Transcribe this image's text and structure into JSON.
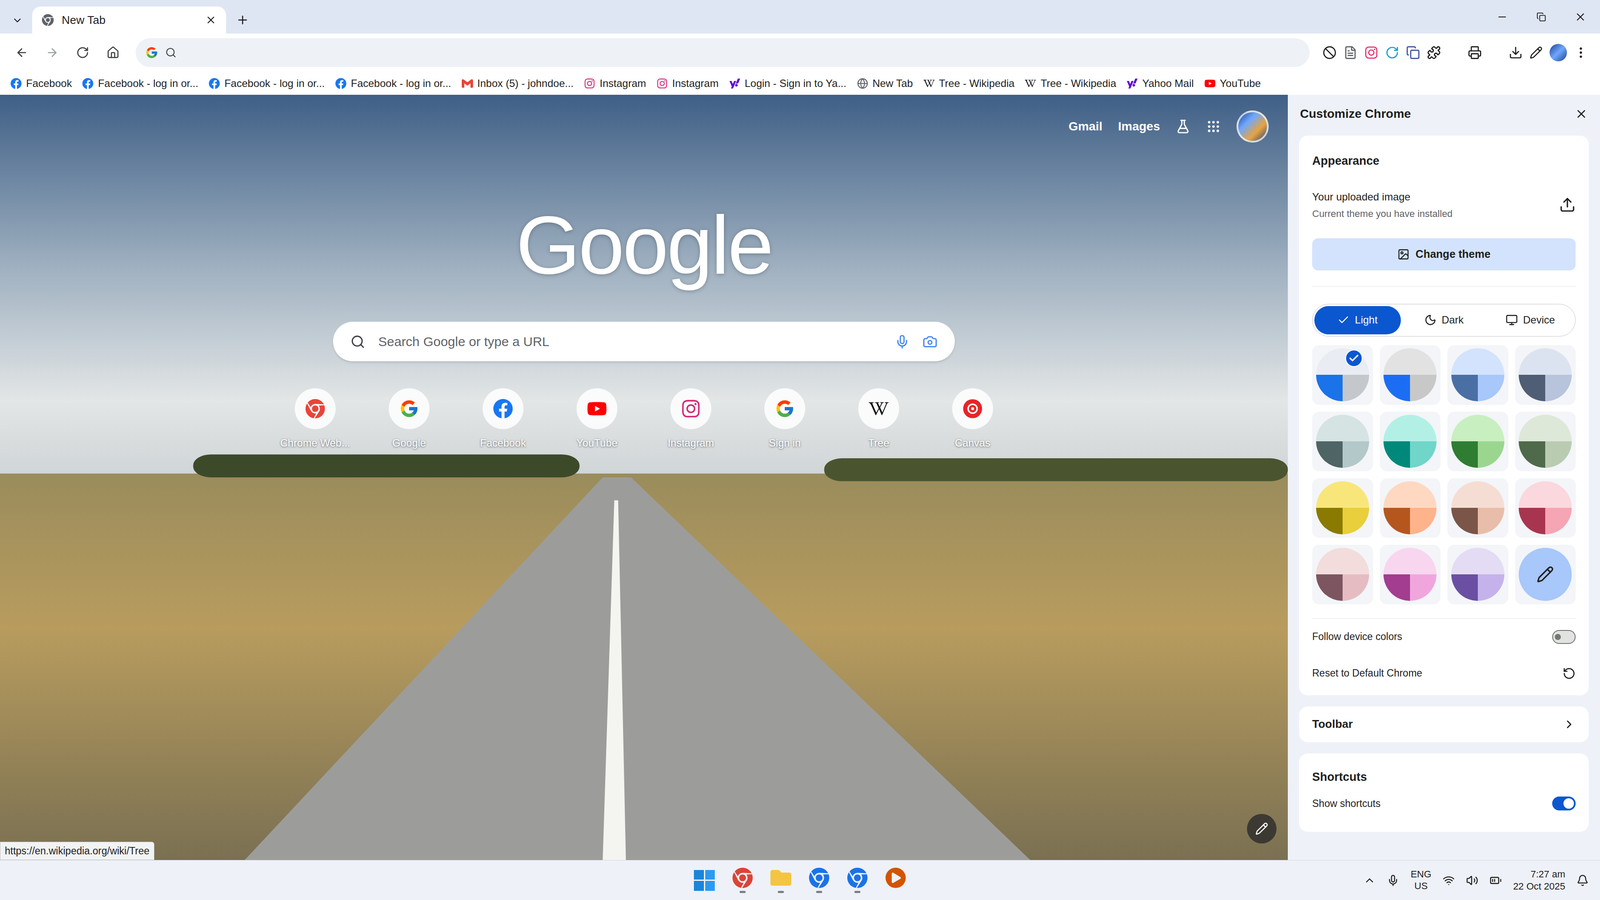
{
  "tabs": [
    {
      "label": "New Tab",
      "selected": true
    }
  ],
  "bookmarks": [
    {
      "label": "Facebook",
      "kind": "facebook"
    },
    {
      "label": "Facebook - log in or...",
      "kind": "facebook"
    },
    {
      "label": "Facebook - log in or...",
      "kind": "facebook"
    },
    {
      "label": "Facebook - log in or...",
      "kind": "facebook"
    },
    {
      "label": "Inbox (5) - johndoe...",
      "kind": "gmail"
    },
    {
      "label": "Instagram",
      "kind": "instagram"
    },
    {
      "label": "Instagram",
      "kind": "instagram"
    },
    {
      "label": "Login - Sign in to Ya...",
      "kind": "yahoo"
    },
    {
      "label": "New Tab",
      "kind": "globe"
    },
    {
      "label": "Tree - Wikipedia",
      "kind": "wikipedia"
    },
    {
      "label": "Tree - Wikipedia",
      "kind": "wikipedia"
    },
    {
      "label": "Yahoo Mail",
      "kind": "yahoo"
    },
    {
      "label": "YouTube",
      "kind": "youtube"
    }
  ],
  "ntp": {
    "links": [
      "Gmail",
      "Images"
    ],
    "logo": "Google",
    "search_placeholder": "Search Google or type a URL",
    "shortcuts": [
      {
        "label": "Chrome Web...",
        "kind": "webstore"
      },
      {
        "label": "Google",
        "kind": "google"
      },
      {
        "label": "Facebook",
        "kind": "facebook"
      },
      {
        "label": "YouTube",
        "kind": "youtube"
      },
      {
        "label": "Instagram",
        "kind": "instagram"
      },
      {
        "label": "Sign in",
        "kind": "google"
      },
      {
        "label": "Tree",
        "kind": "wikipedia"
      },
      {
        "label": "Canvas",
        "kind": "canvas"
      }
    ]
  },
  "status_url": "https://en.wikipedia.org/wiki/Tree",
  "panel": {
    "title": "Customize Chrome",
    "appearance": {
      "heading": "Appearance",
      "theme_title": "Your uploaded image",
      "theme_subtitle": "Current theme you have installed",
      "change_theme": "Change theme",
      "modes": [
        {
          "label": "Light",
          "kind": "light",
          "selected": true
        },
        {
          "label": "Dark",
          "kind": "dark",
          "selected": false
        },
        {
          "label": "Device",
          "kind": "device",
          "selected": false
        }
      ],
      "swatches": [
        {
          "kind": "preset",
          "selected": true,
          "colors": [
            "#e9ecf2",
            "#1a73e8",
            "#c4c7cc"
          ]
        },
        {
          "kind": "preset",
          "selected": false,
          "colors": [
            "#e2e2e2",
            "#1b6ef3",
            "#c8c8c8"
          ]
        },
        {
          "kind": "preset",
          "selected": false,
          "colors": [
            "#d3e3fd",
            "#4a6fa5",
            "#a8c7fa"
          ]
        },
        {
          "kind": "preset",
          "selected": false,
          "colors": [
            "#dce3f0",
            "#4f5d75",
            "#b8c4dc"
          ]
        },
        {
          "kind": "preset",
          "selected": false,
          "colors": [
            "#d6e3e3",
            "#4f6464",
            "#b3c8c8"
          ]
        },
        {
          "kind": "preset",
          "selected": false,
          "colors": [
            "#b2f0e6",
            "#00897b",
            "#6fd6c9"
          ]
        },
        {
          "kind": "preset",
          "selected": false,
          "colors": [
            "#c8efc0",
            "#2e7d32",
            "#9bd68f"
          ]
        },
        {
          "kind": "preset",
          "selected": false,
          "colors": [
            "#dde8d8",
            "#4e6a4a",
            "#b9ccb2"
          ]
        },
        {
          "kind": "preset",
          "selected": false,
          "colors": [
            "#f9e67a",
            "#8a7a00",
            "#e8cf3b"
          ]
        },
        {
          "kind": "preset",
          "selected": false,
          "colors": [
            "#ffd8c2",
            "#b5561f",
            "#ffb38a"
          ]
        },
        {
          "kind": "preset",
          "selected": false,
          "colors": [
            "#f6ddd3",
            "#7a5548",
            "#e8bdaa"
          ]
        },
        {
          "kind": "preset",
          "selected": false,
          "colors": [
            "#fbd7de",
            "#a8354f",
            "#f5a5b4"
          ]
        },
        {
          "kind": "preset",
          "selected": false,
          "colors": [
            "#f3dcdc",
            "#7d5560",
            "#e6bcc3"
          ]
        },
        {
          "kind": "preset",
          "selected": false,
          "colors": [
            "#f8d6ef",
            "#a23d8f",
            "#f0a6dd"
          ]
        },
        {
          "kind": "preset",
          "selected": false,
          "colors": [
            "#e4dbf5",
            "#6b4fa3",
            "#c5b2eb"
          ]
        },
        {
          "kind": "custom",
          "selected": false,
          "colors": [
            "#a8c7fa"
          ]
        }
      ],
      "follow_device_colors": {
        "label": "Follow device colors",
        "on": false
      },
      "reset": "Reset to Default Chrome"
    },
    "toolbar": "Toolbar",
    "shortcuts": {
      "heading": "Shortcuts",
      "show_shortcuts": {
        "label": "Show shortcuts",
        "on": true
      }
    }
  },
  "taskbar": {
    "language": "ENG",
    "region": "US",
    "time": "7:27 am",
    "date": "22 Oct 2025"
  }
}
